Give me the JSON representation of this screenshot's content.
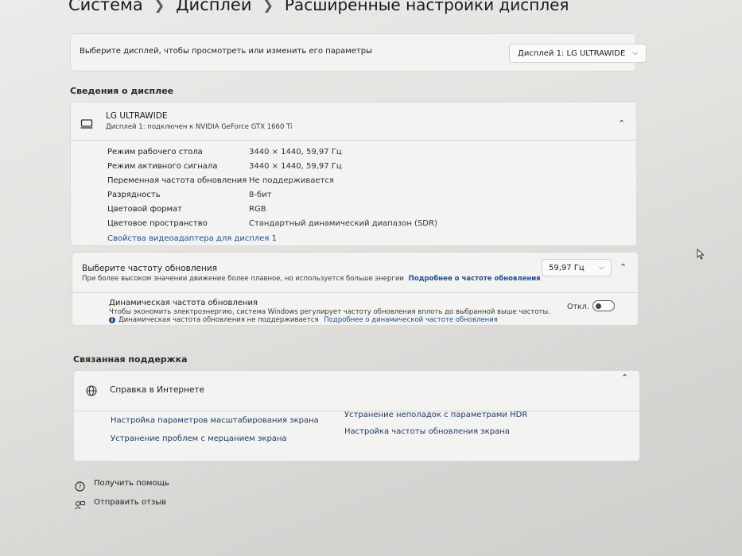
{
  "breadcrumb": {
    "item1": "Система",
    "item2": "Дисплей",
    "current": "Расширенные настройки дисплея"
  },
  "select_display": {
    "prompt": "Выберите дисплей, чтобы просмотреть или изменить его параметры",
    "value": "Дисплей 1: LG ULTRAWIDE"
  },
  "display_info": {
    "section_title": "Сведения о дисплее",
    "name": "LG ULTRAWIDE",
    "subtitle": "Дисплей 1: подключен к NVIDIA GeForce GTX 1660 Ti",
    "rows": [
      {
        "label": "Режим рабочего стола",
        "value": "3440 × 1440, 59,97 Гц"
      },
      {
        "label": "Режим активного сигнала",
        "value": "3440 × 1440, 59,97 Гц"
      },
      {
        "label": "Переменная частота обновления",
        "value": "Не поддерживается"
      },
      {
        "label": "Разрядность",
        "value": "8-бит"
      },
      {
        "label": "Цветовой формат",
        "value": "RGB"
      },
      {
        "label": "Цветовое пространство",
        "value": "Стандартный динамический диапазон (SDR)"
      }
    ],
    "adapter_link": "Свойства видеоадаптера для дисплея 1"
  },
  "refresh": {
    "title": "Выберите частоту обновления",
    "desc": "При более высоком значении движение более плавное, но используется больше энергии",
    "link": "Подробнее о частоте обновления",
    "value": "59,97 Гц",
    "dynamic_title": "Динамическая частота обновления",
    "dynamic_desc": "Чтобы экономить электроэнергию, система Windows регулирует частоту обновления вплоть до выбранной выше частоты.",
    "dynamic_note": "Динамическая частота обновления не поддерживается",
    "dynamic_link": "Подробнее о динамической частоте обновления",
    "toggle_label": "Откл."
  },
  "support": {
    "section_title": "Связанная поддержка",
    "help_title": "Справка в Интернете",
    "links": {
      "a": "Настройка параметров масштабирования экрана",
      "b": "Устранение неполадок с параметрами HDR",
      "c": "Устранение проблем с мерцанием экрана",
      "d": "Настройка частоты обновления экрана"
    }
  },
  "footer": {
    "help": "Получить помощь",
    "feedback": "Отправить отзыв"
  }
}
